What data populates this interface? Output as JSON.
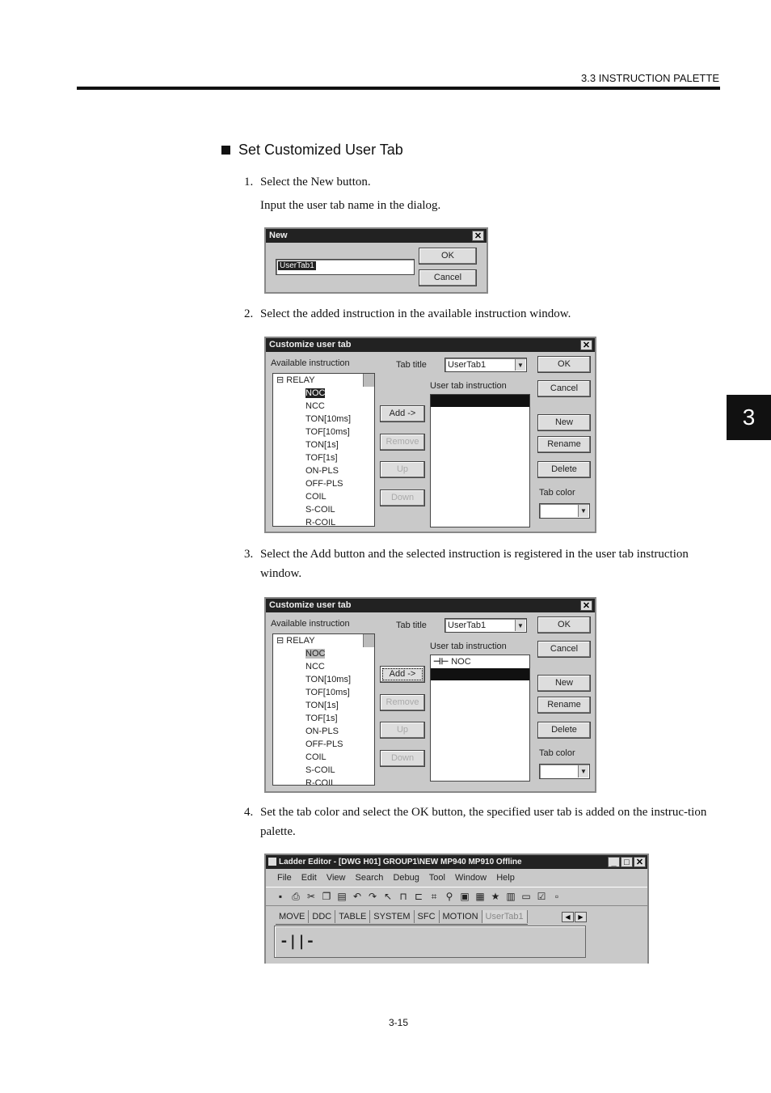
{
  "header": {
    "running_head": "3.3  INSTRUCTION PALETTE",
    "chapter_tab": "3"
  },
  "section": {
    "title": "Set Customized User Tab"
  },
  "steps": [
    {
      "num": "1.",
      "text": "Select the New button."
    },
    {
      "num": "2.",
      "text": "Select the added instruction in the available instruction window."
    },
    {
      "num": "3.",
      "text": "Select the Add button and the selected instruction is registered in the user tab instruction window."
    },
    {
      "num": "4.",
      "text": "Set the tab color and select the OK button, the specified user tab is added on the instruc-tion palette."
    }
  ],
  "step1_note": "Input the user tab name in the dialog.",
  "new_dialog": {
    "title": "New",
    "input_value": "UserTab1",
    "ok": "OK",
    "cancel": "Cancel"
  },
  "customize_dialog": {
    "title": "Customize user tab",
    "available_label": "Available instruction",
    "tab_title_label": "Tab title",
    "tab_title_value": "UserTab1",
    "user_tab_label": "User tab instruction",
    "tree_root": "RELAY",
    "tree_items": [
      "NOC",
      "NCC",
      "TON[10ms]",
      "TOF[10ms]",
      "TON[1s]",
      "TOF[1s]",
      "ON-PLS",
      "OFF-PLS",
      "COIL",
      "S-COIL",
      "R-COIL"
    ],
    "buttons": {
      "add": "Add ->",
      "remove": "Remove",
      "up": "Up",
      "down": "Down",
      "ok": "OK",
      "cancel": "Cancel",
      "new": "New",
      "rename": "Rename",
      "delete": "Delete"
    },
    "tab_color_label": "Tab color",
    "registered_item": "NOC"
  },
  "ladder_window": {
    "title": "Ladder Editor - [DWG H01]   GROUP1\\NEW  MP940  MP910    Offline",
    "menu": [
      "File",
      "Edit",
      "View",
      "Search",
      "Debug",
      "Tool",
      "Window",
      "Help"
    ],
    "tabs": [
      "MOVE",
      "DDC",
      "TABLE",
      "SYSTEM",
      "SFC",
      "MOTION",
      "UserTab1"
    ],
    "palette_symbol": "-||-"
  },
  "footer": {
    "page_number": "3-15"
  }
}
